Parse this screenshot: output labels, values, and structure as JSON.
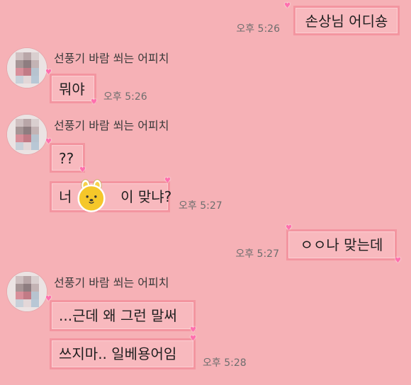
{
  "contact": {
    "name": "선풍기 바람 쐬는 어피치"
  },
  "messages": [
    {
      "text": "손상님 어디숑",
      "time": "오후 5:26",
      "from": "me"
    },
    {
      "text": "뭐야",
      "time": "오후 5:26",
      "from": "peer"
    },
    {
      "text": "??",
      "time": "",
      "from": "peer"
    },
    {
      "text_left": "너",
      "text_right": "이 맞냐?",
      "time": "오후 5:27",
      "from": "peer",
      "sticker": "yellow-bear-sticker-icon"
    },
    {
      "text": "ㅇㅇ나 맞는데",
      "time": "오후 5:27",
      "from": "me"
    },
    {
      "text": "...근데 왜 그런 말써",
      "time": "",
      "from": "peer"
    },
    {
      "text": "쓰지마.. 일베용어임",
      "time": "오후 5:28",
      "from": "peer"
    }
  ],
  "colors": {
    "background": "#f6b1b6",
    "bubble_fill": "#f8b9be",
    "bubble_border": "#f395a0",
    "heart": "#ff6fae",
    "time_text": "#6e6e6e"
  },
  "icons": {
    "heart": "heart-icon",
    "avatar": "pixelated-avatar",
    "sticker": "yellow-bear-sticker-icon"
  }
}
